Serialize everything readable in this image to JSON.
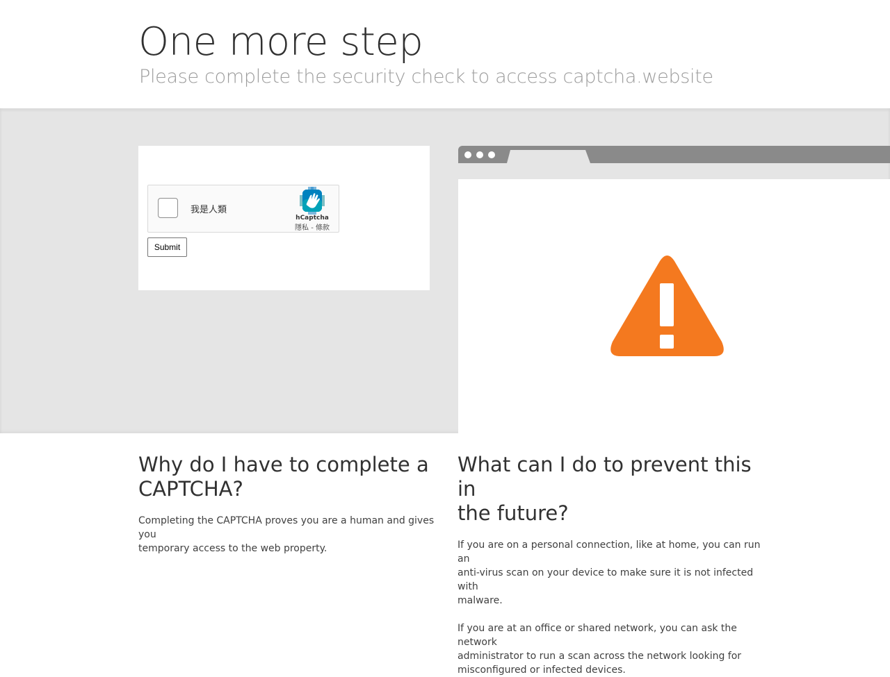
{
  "header": {
    "title": "One more step",
    "subtitle": "Please complete the security check to access captcha.website"
  },
  "captcha": {
    "checkbox_label": "我是人類",
    "brand": "hCaptcha",
    "links": "隱私 - 條款",
    "submit_label": "Submit"
  },
  "illustration": {
    "icon": "warning-icon",
    "accent_color": "#f4791f"
  },
  "left_section": {
    "heading_line1": "Why do I have to complete a",
    "heading_line2": "CAPTCHA?",
    "para_line1": "Completing the CAPTCHA proves you are a human and gives you",
    "para_line2": "temporary access to the web property."
  },
  "right_section": {
    "heading_line1": "What can I do to prevent this in",
    "heading_line2": "the future?",
    "para1_line1": "If you are on a personal connection, like at home, you can run an",
    "para1_line2": "anti-virus scan on your device to make sure it is not infected with",
    "para1_line3": "malware.",
    "para2_line1": "If you are at an office or shared network, you can ask the network",
    "para2_line2": "administrator to run a scan across the network looking for",
    "para2_line3": "misconfigured or infected devices."
  }
}
